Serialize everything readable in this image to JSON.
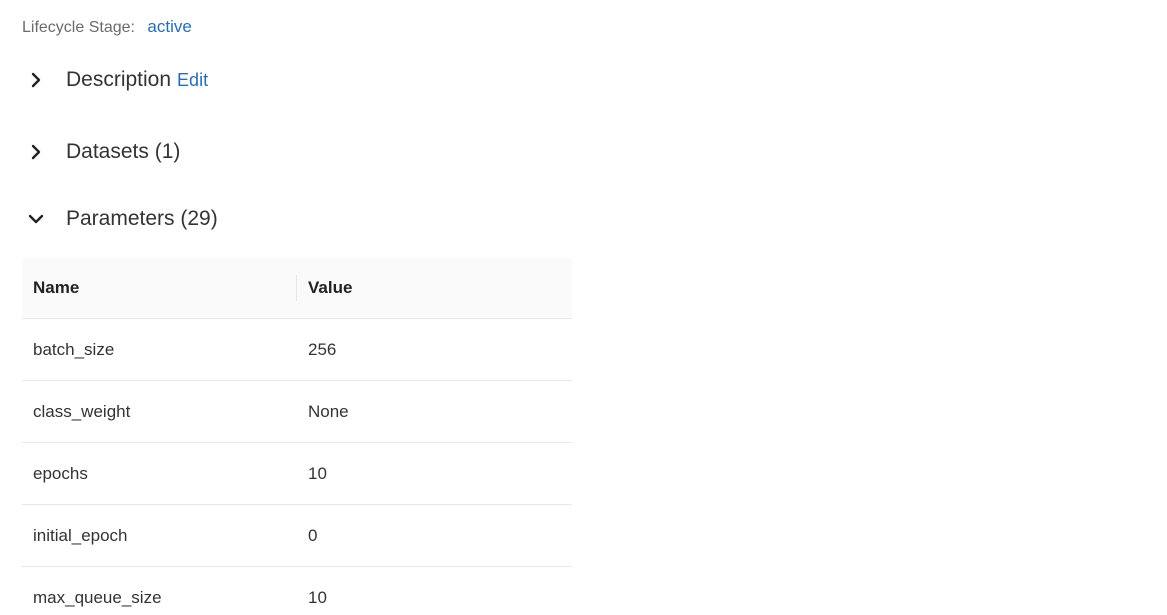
{
  "lifecycle": {
    "label": "Lifecycle Stage:",
    "value": "active"
  },
  "sections": {
    "description": {
      "title": "Description",
      "edit_label": "Edit",
      "expanded": false
    },
    "datasets": {
      "title": "Datasets (1)",
      "expanded": false
    },
    "parameters": {
      "title": "Parameters (29)",
      "expanded": true
    }
  },
  "parameters_table": {
    "columns": [
      "Name",
      "Value"
    ],
    "rows": [
      {
        "name": "batch_size",
        "value": "256"
      },
      {
        "name": "class_weight",
        "value": "None"
      },
      {
        "name": "epochs",
        "value": "10"
      },
      {
        "name": "initial_epoch",
        "value": "0"
      },
      {
        "name": "max_queue_size",
        "value": "10"
      }
    ]
  },
  "icons": {
    "collapsed": "chevron-right-icon",
    "expanded": "chevron-down-icon"
  },
  "colors": {
    "link": "#2b6cb0",
    "text": "#333333",
    "muted": "#6b6b6b"
  }
}
